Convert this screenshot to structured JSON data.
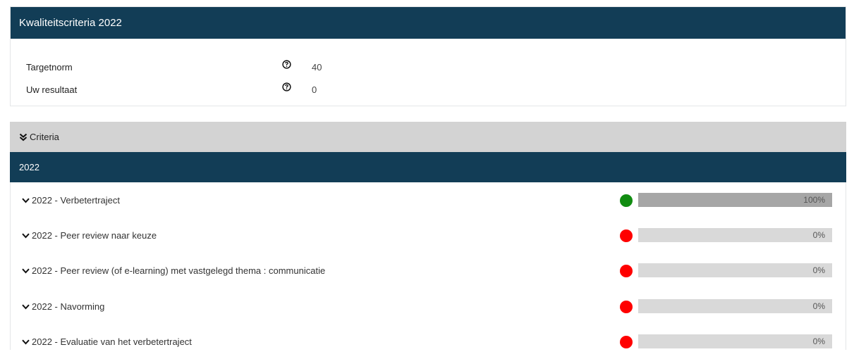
{
  "summary": {
    "title": "Kwaliteitscriteria 2022",
    "rows": [
      {
        "label": "Targetnorm",
        "value": "40"
      },
      {
        "label": "Uw resultaat",
        "value": "0"
      }
    ]
  },
  "criteria": {
    "toggle_label": "Criteria",
    "year": "2022",
    "items": [
      {
        "label": "2022 - Verbetertraject",
        "status": "green",
        "progress": 1.0,
        "progress_label": "100%"
      },
      {
        "label": "2022 - Peer review naar keuze",
        "status": "red",
        "progress": 0,
        "progress_label": "0%"
      },
      {
        "label": "2022 - Peer review (of e-learning) met vastgelegd thema : communicatie",
        "status": "red",
        "progress": 0,
        "progress_label": "0%"
      },
      {
        "label": "2022 - Navorming",
        "status": "red",
        "progress": 0,
        "progress_label": "0%"
      },
      {
        "label": "2022 - Evaluatie van het verbetertraject",
        "status": "red",
        "progress": 0,
        "progress_label": "0%"
      }
    ]
  },
  "colors": {
    "header": "#123d56",
    "green": "#118c11",
    "red": "#ff0000"
  },
  "icons": {
    "help": "help-circle-icon",
    "expand": "chevron-down-icon",
    "collapse": "double-chevron-down-icon"
  }
}
